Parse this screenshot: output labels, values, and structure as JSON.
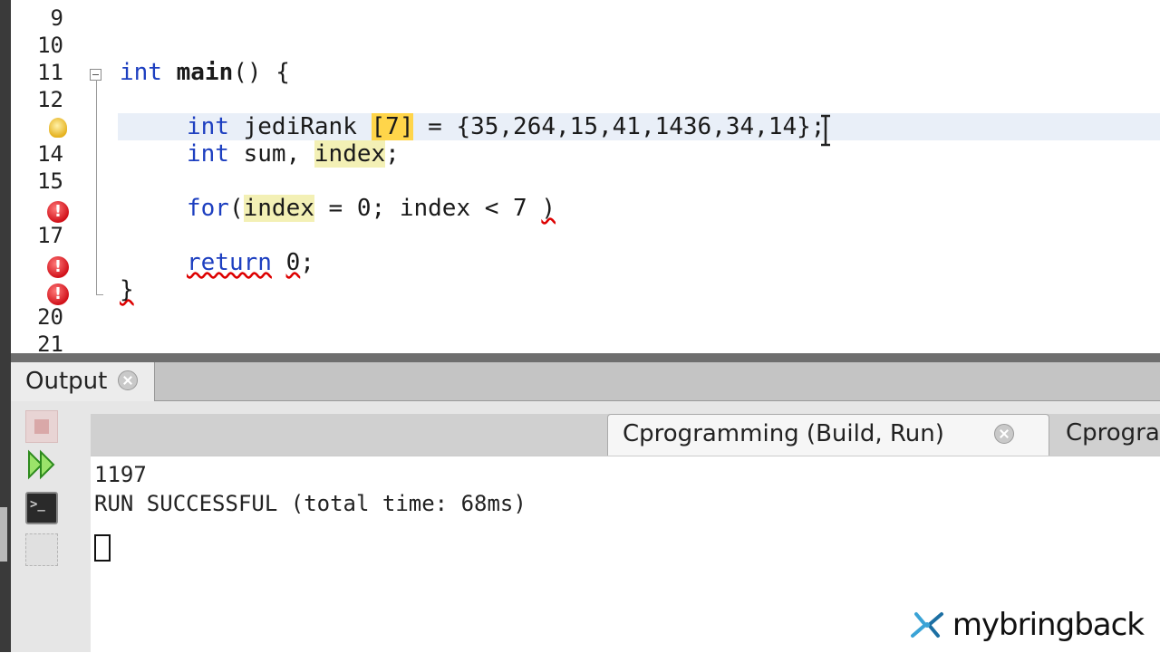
{
  "editor": {
    "lines": [
      {
        "num": "9",
        "code": ""
      },
      {
        "num": "10",
        "code": ""
      },
      {
        "num": "11",
        "code_parts": [
          "int",
          " ",
          "main",
          "() {"
        ]
      },
      {
        "num": "12",
        "code": ""
      },
      {
        "num": "",
        "code_parts": [
          "int",
          " jediRank ",
          "[",
          "7",
          "]",
          " = {35,264,15,41,1436,34,14};"
        ]
      },
      {
        "num": "14",
        "code_parts": [
          "int",
          " sum, ",
          "index",
          ";"
        ]
      },
      {
        "num": "15",
        "code": ""
      },
      {
        "num": "",
        "code_parts": [
          "for",
          "(",
          "index",
          " = 0; index < 7 ",
          ")"
        ]
      },
      {
        "num": "17",
        "code": ""
      },
      {
        "num": "",
        "code_parts": [
          "return",
          " ",
          "0",
          ";"
        ]
      },
      {
        "num": "",
        "code": "}"
      },
      {
        "num": "20",
        "code": ""
      },
      {
        "num": "21",
        "code": ""
      }
    ]
  },
  "output": {
    "tab_label": "Output",
    "run_tabs": [
      {
        "label": "Cprogramming (Build, Run)",
        "active": true
      },
      {
        "label": "Cprogra",
        "active": false
      }
    ],
    "console_lines": [
      "1197",
      "RUN SUCCESSFUL (total time: 68ms)"
    ]
  },
  "watermark": {
    "text": "mybringback"
  },
  "colors": {
    "keyword": "#1d3fc0",
    "error": "#d1111a",
    "occurrence_highlight": "#f3f0b5",
    "bracket_highlight": "#ffd54a"
  },
  "icons": [
    "fold-toggle-icon",
    "lightbulb-hint-icon",
    "error-icon",
    "close-icon",
    "stop-icon",
    "rerun-icon",
    "terminal-icon"
  ]
}
